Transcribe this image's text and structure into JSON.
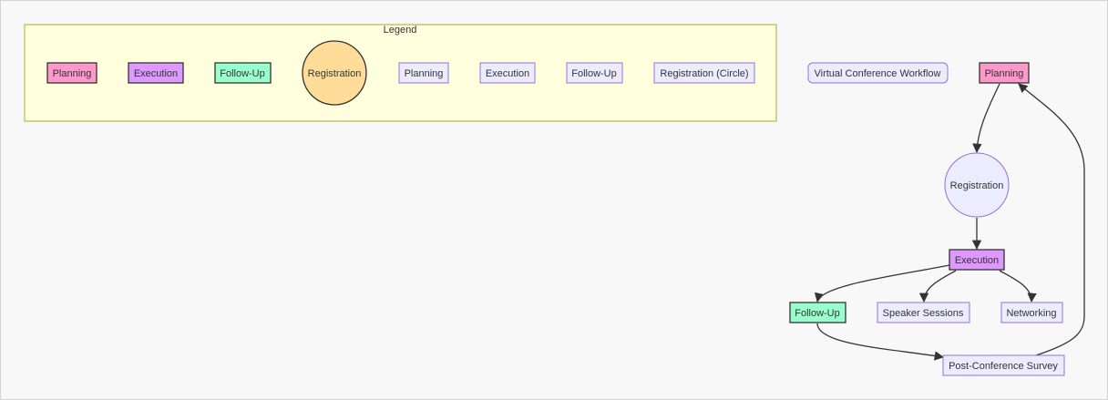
{
  "colors": {
    "planning": "#ff99cc",
    "execution": "#dd99ff",
    "follow_up": "#99ffcc",
    "registration": "#ffdd99",
    "default_fill": "#ececff",
    "default_stroke": "#9370db",
    "legend_fill": "#ffffde",
    "legend_stroke": "#aaaa33",
    "edge": "#333333"
  },
  "legend": {
    "title": "Legend",
    "items": [
      {
        "label": "Planning",
        "style": "planning"
      },
      {
        "label": "Execution",
        "style": "execution"
      },
      {
        "label": "Follow-Up",
        "style": "follow_up"
      },
      {
        "label": "Registration",
        "style": "registration",
        "shape": "circle"
      },
      {
        "label": "Planning",
        "style": "default"
      },
      {
        "label": "Execution",
        "style": "default"
      },
      {
        "label": "Follow-Up",
        "style": "default"
      },
      {
        "label": "Registration (Circle)",
        "style": "default"
      }
    ]
  },
  "workflow": {
    "title": "Virtual Conference Workflow",
    "nodes": {
      "planning": "Planning",
      "registration": "Registration",
      "execution": "Execution",
      "follow_up": "Follow-Up",
      "speaker_sessions": "Speaker Sessions",
      "networking": "Networking",
      "post_survey": "Post-Conference Survey"
    },
    "edges": [
      {
        "from": "planning",
        "to": "registration"
      },
      {
        "from": "registration",
        "to": "execution"
      },
      {
        "from": "execution",
        "to": "follow_up"
      },
      {
        "from": "execution",
        "to": "speaker_sessions"
      },
      {
        "from": "execution",
        "to": "networking"
      },
      {
        "from": "follow_up",
        "to": "post_survey"
      },
      {
        "from": "post_survey",
        "to": "planning"
      }
    ]
  }
}
